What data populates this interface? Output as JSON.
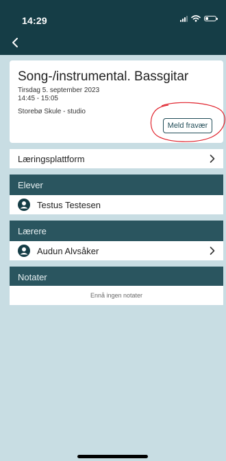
{
  "status_bar": {
    "time": "14:29"
  },
  "lesson": {
    "title": "Song-/instrumental. Bassgitar",
    "date": "Tirsdag 5. september 2023",
    "time_range": "14:45 - 15:05",
    "place": "Storebø Skule - studio",
    "absence_button": "Meld fravær"
  },
  "learning_platform": {
    "label": "Læringsplattform"
  },
  "students": {
    "header": "Elever",
    "items": [
      "Testus Testesen"
    ]
  },
  "teachers": {
    "header": "Lærere",
    "items": [
      "Audun Alvsåker"
    ]
  },
  "notes": {
    "header": "Notater",
    "empty_text": "Ennå ingen notater"
  },
  "colors": {
    "header": "#153d46",
    "section": "#2a555f",
    "background": "#c8dde3",
    "annotation": "#e0202a"
  },
  "icons": {
    "back": "chevron-left-icon",
    "chevron": "chevron-right-icon",
    "person": "person-circle-icon",
    "signal": "signal-icon",
    "wifi": "wifi-icon",
    "battery": "battery-icon"
  }
}
